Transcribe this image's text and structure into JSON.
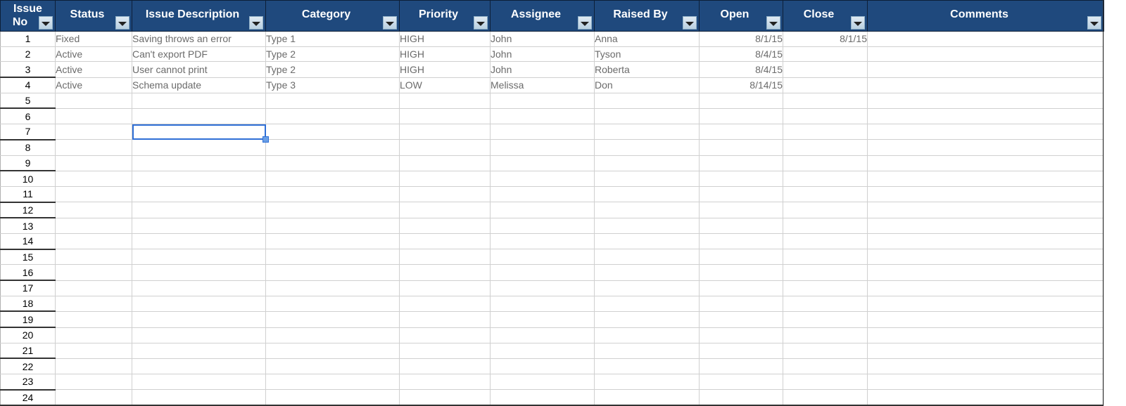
{
  "columns": [
    {
      "key": "issue_no",
      "label": "Issue No",
      "line1": "Issue",
      "line2": "No"
    },
    {
      "key": "status",
      "label": "Status"
    },
    {
      "key": "description",
      "label": "Issue Description"
    },
    {
      "key": "category",
      "label": "Category"
    },
    {
      "key": "priority",
      "label": "Priority"
    },
    {
      "key": "assignee",
      "label": "Assignee"
    },
    {
      "key": "raised_by",
      "label": "Raised By"
    },
    {
      "key": "open",
      "label": "Open"
    },
    {
      "key": "close",
      "label": "Close"
    },
    {
      "key": "comments",
      "label": "Comments"
    }
  ],
  "rows": [
    {
      "issue_no": "1",
      "status": "Fixed",
      "description": "Saving throws an error",
      "category": "Type 1",
      "priority": "HIGH",
      "assignee": "John",
      "raised_by": "Anna",
      "open": "8/1/15",
      "close": "8/1/15",
      "comments": ""
    },
    {
      "issue_no": "2",
      "status": "Active",
      "description": "Can't export PDF",
      "category": "Type 2",
      "priority": "HIGH",
      "assignee": "John",
      "raised_by": "Tyson",
      "open": "8/4/15",
      "close": "",
      "comments": ""
    },
    {
      "issue_no": "3",
      "status": "Active",
      "description": "User cannot print",
      "category": "Type 2",
      "priority": "HIGH",
      "assignee": "John",
      "raised_by": "Roberta",
      "open": "8/4/15",
      "close": "",
      "comments": ""
    },
    {
      "issue_no": "4",
      "status": "Active",
      "description": "Schema update",
      "category": "Type 3",
      "priority": "LOW",
      "assignee": "Melissa",
      "raised_by": "Don",
      "open": "8/14/15",
      "close": "",
      "comments": ""
    },
    {
      "issue_no": "5"
    },
    {
      "issue_no": "6"
    },
    {
      "issue_no": "7"
    },
    {
      "issue_no": "8"
    },
    {
      "issue_no": "9"
    },
    {
      "issue_no": "10"
    },
    {
      "issue_no": "11"
    },
    {
      "issue_no": "12"
    },
    {
      "issue_no": "13"
    },
    {
      "issue_no": "14"
    },
    {
      "issue_no": "15"
    },
    {
      "issue_no": "16"
    },
    {
      "issue_no": "17"
    },
    {
      "issue_no": "18"
    },
    {
      "issue_no": "19"
    },
    {
      "issue_no": "20"
    },
    {
      "issue_no": "21"
    },
    {
      "issue_no": "22"
    },
    {
      "issue_no": "23"
    },
    {
      "issue_no": "24"
    }
  ],
  "selected_cell": {
    "row": "7",
    "column": "description"
  },
  "colors": {
    "header_bg": "#1f497d",
    "header_text": "#ffffff",
    "selection": "#2f6fd6"
  }
}
